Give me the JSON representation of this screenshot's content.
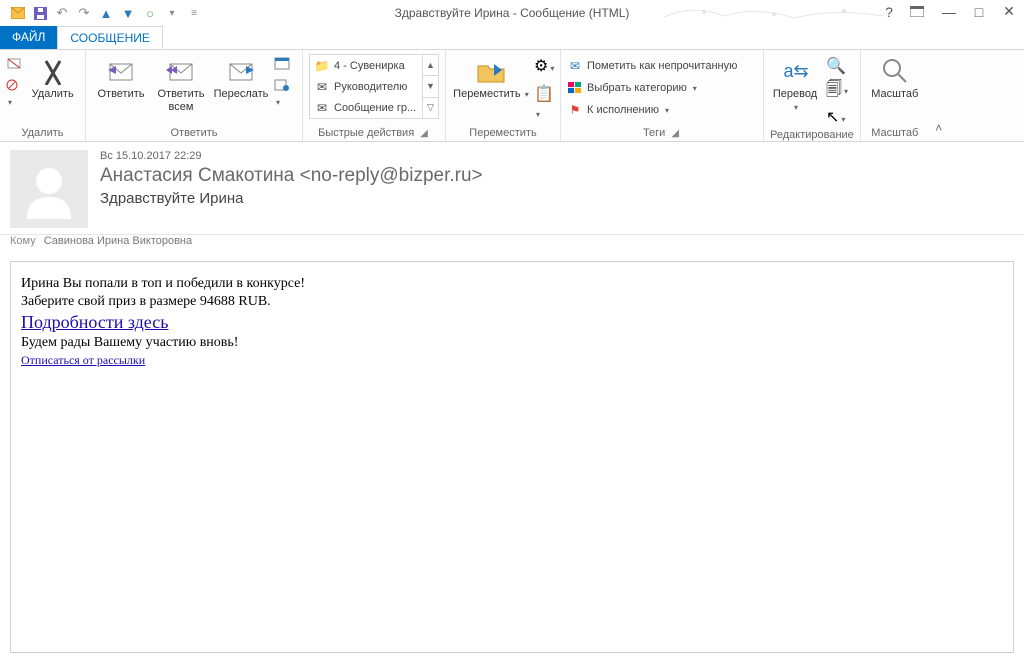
{
  "window": {
    "title": "Здравствуйте Ирина - Сообщение (HTML)"
  },
  "tabs": {
    "file": "ФАЙЛ",
    "message": "СООБЩЕНИЕ"
  },
  "ribbon": {
    "delete": {
      "delete": "Удалить",
      "group": "Удалить"
    },
    "respond": {
      "reply": "Ответить",
      "replyAll": "Ответить всем",
      "forward": "Переслать",
      "group": "Ответить"
    },
    "quick": {
      "i1": "4 - Сувенирка",
      "i2": "Руководителю",
      "i3": "Сообщение гр...",
      "group": "Быстрые действия"
    },
    "move": {
      "move": "Переместить",
      "group": "Переместить"
    },
    "tags": {
      "unread": "Пометить как непрочитанную",
      "cat": "Выбрать категорию",
      "follow": "К исполнению",
      "group": "Теги"
    },
    "edit": {
      "translate": "Перевод",
      "group": "Редактирование"
    },
    "zoom": {
      "zoom": "Масштаб",
      "group": "Масштаб"
    }
  },
  "message": {
    "date": "Вс 15.10.2017 22:29",
    "from": "Анастасия Смакотина <no-reply@bizper.ru>",
    "subject": "Здравствуйте Ирина",
    "toLabel": "Кому",
    "to": "Савинова Ирина Викторовна",
    "body": {
      "l1": "Ирина Вы попали в топ и победили в конкурсе!",
      "l2": "Заберите свой приз в размере 94688 RUB.",
      "link1": "Подробности здесь",
      "l3": "Будем рады Вашему участию вновь!",
      "link2": "Отписаться от рассылки"
    }
  }
}
